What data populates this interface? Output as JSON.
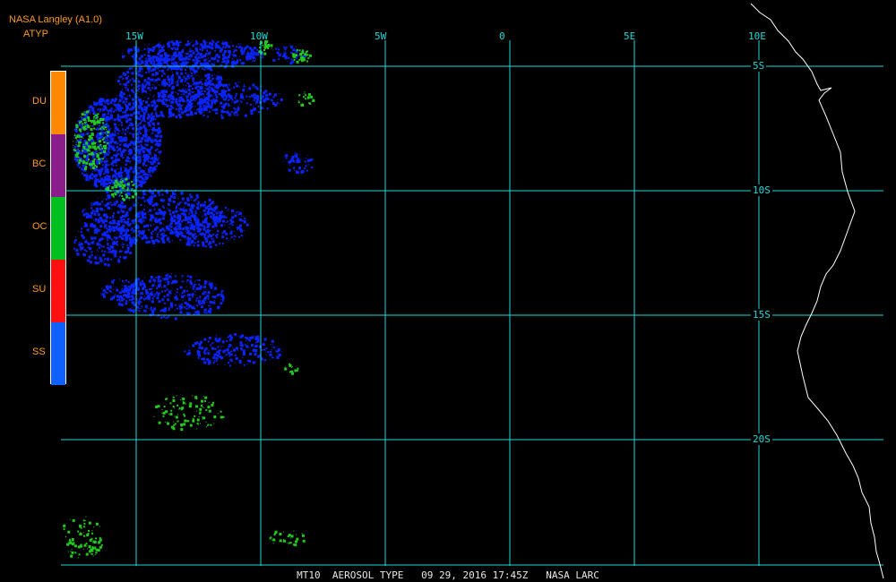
{
  "header": {
    "source": "NASA Langley (A1.0)",
    "product": "ATYP"
  },
  "legend": [
    {
      "code": "DU",
      "color": "#ff8800"
    },
    {
      "code": "BC",
      "color": "#8a1d8a"
    },
    {
      "code": "OC",
      "color": "#00c020"
    },
    {
      "code": "SU",
      "color": "#ff1010"
    },
    {
      "code": "SS",
      "color": "#1060ff"
    }
  ],
  "grid": {
    "color": "#20d8d8",
    "longitudes": [
      "15W",
      "10W",
      "5W",
      "0",
      "5E",
      "10E"
    ],
    "latitudes": [
      "5S",
      "10S",
      "15S",
      "20S"
    ]
  },
  "footer": {
    "caption": "MT10  AEROSOL TYPE   09 29, 2016 17:45Z   NASA LARC"
  },
  "colors": {
    "background": "#000000",
    "coastline": "#ffffff",
    "sea_salt": "#0a24ff",
    "organic_carbon": "#22c81e"
  }
}
